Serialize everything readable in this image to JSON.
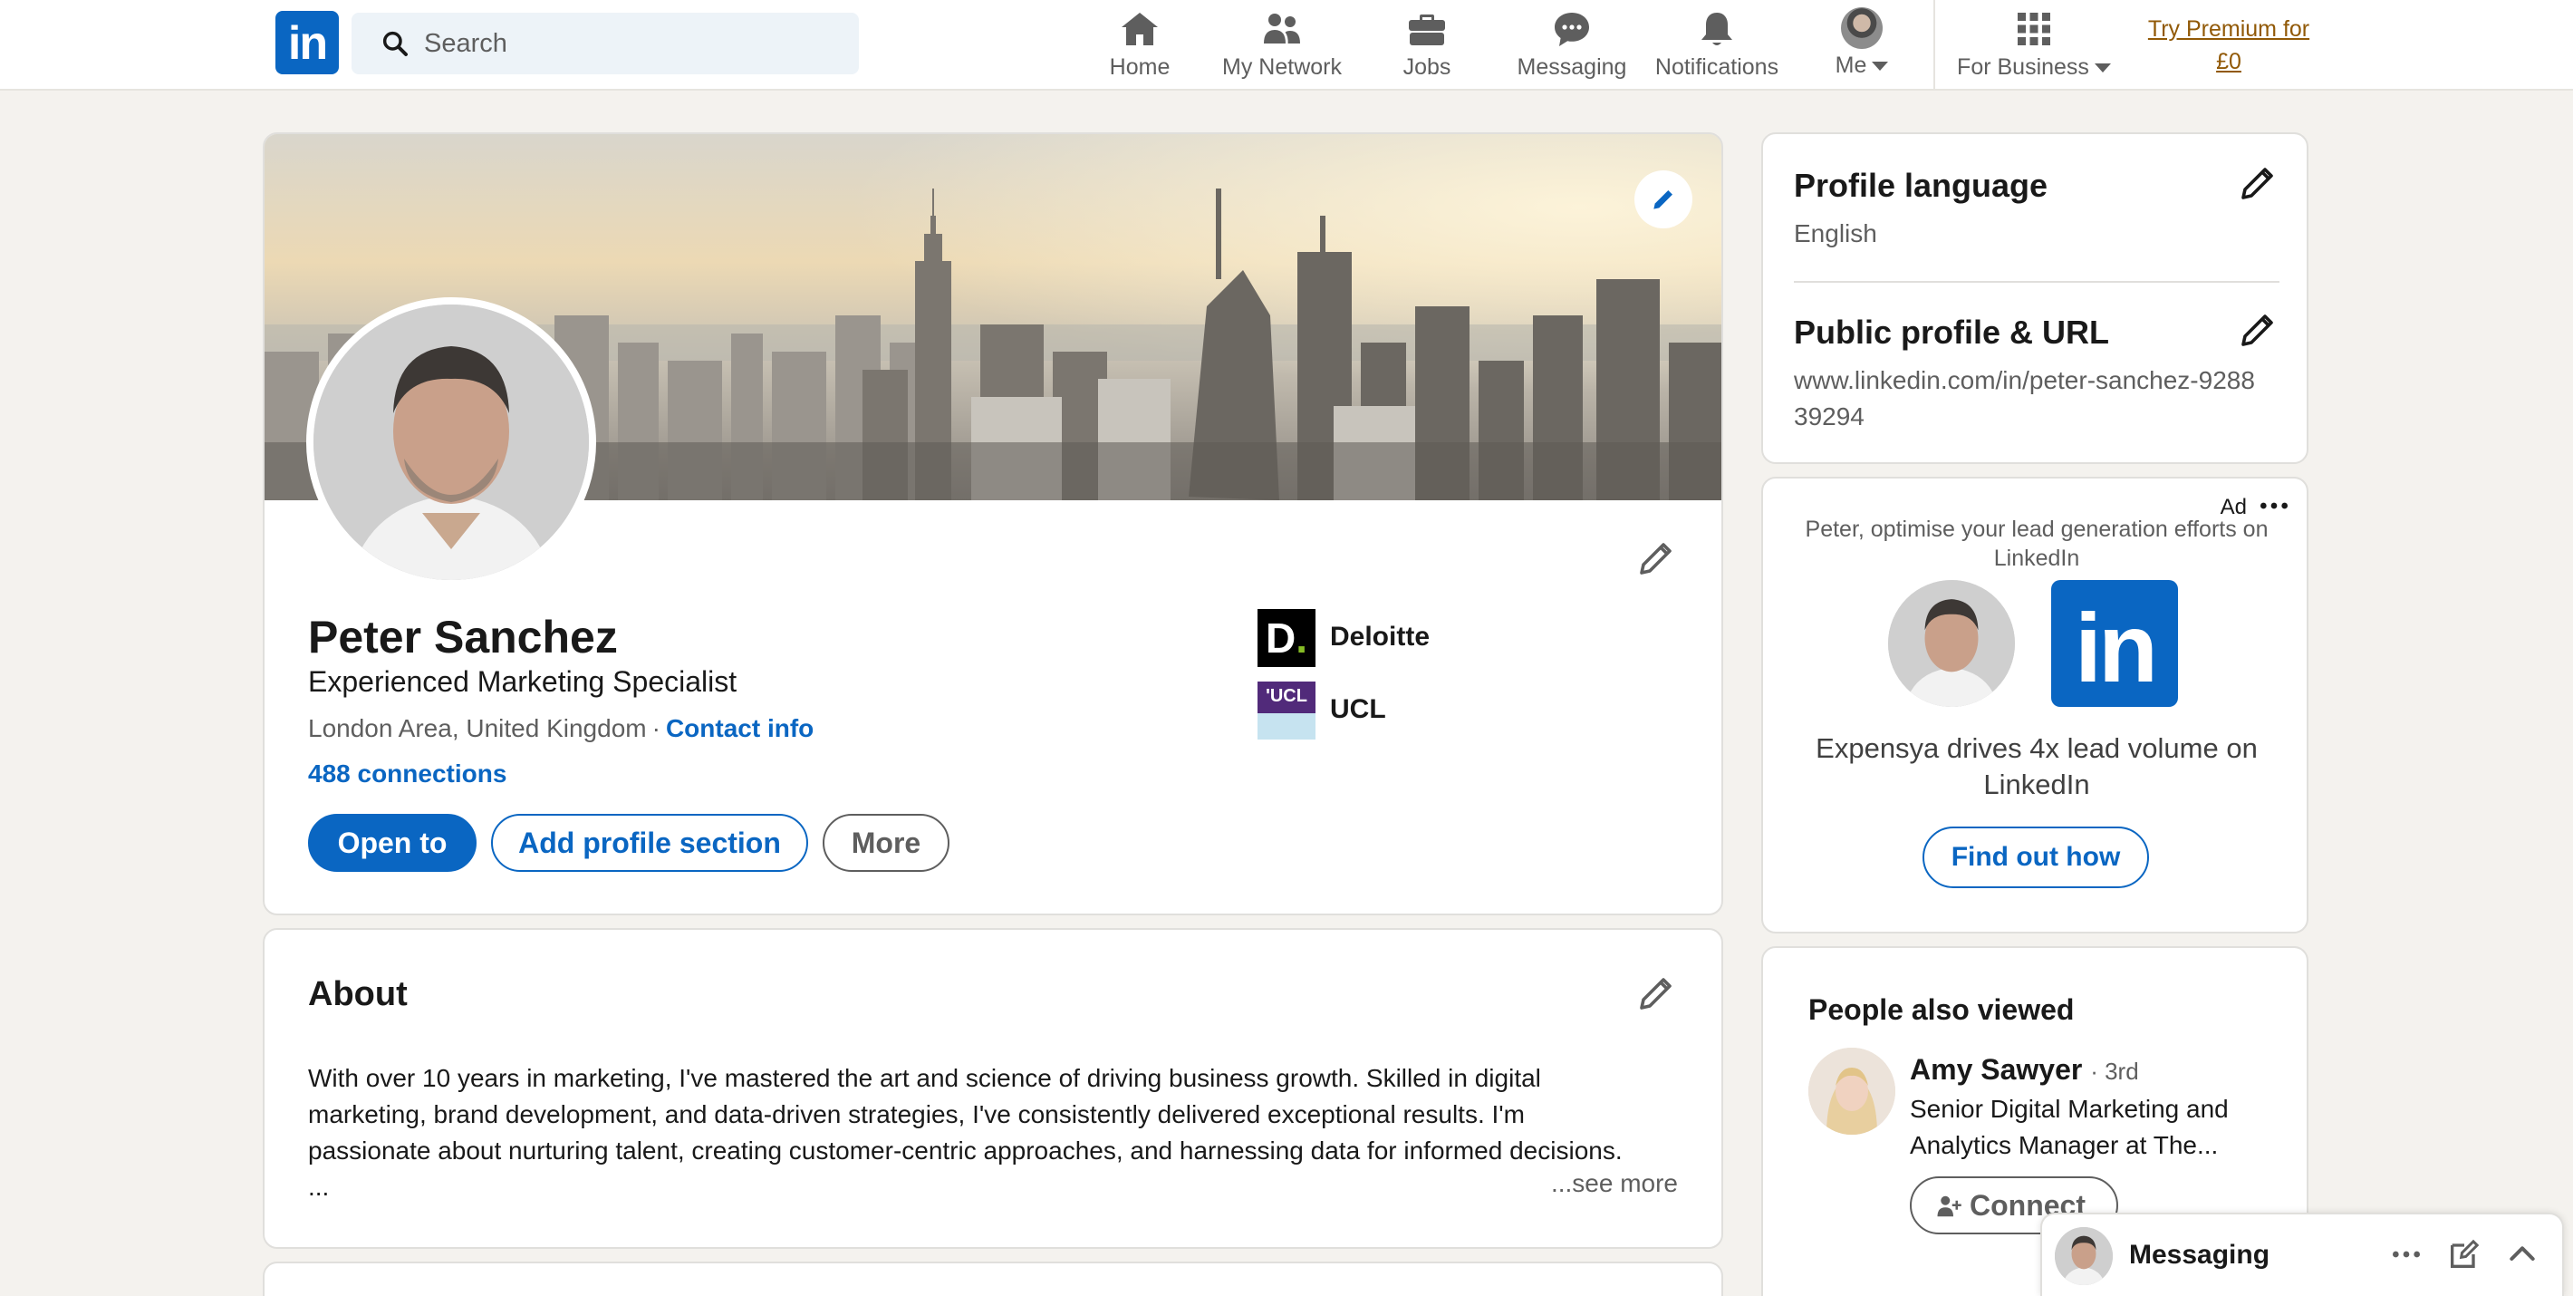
{
  "nav": {
    "logo_text": "in",
    "search_placeholder": "Search",
    "items": [
      {
        "label": "Home",
        "icon": "home-icon"
      },
      {
        "label": "My Network",
        "icon": "network-icon"
      },
      {
        "label": "Jobs",
        "icon": "briefcase-icon"
      },
      {
        "label": "Messaging",
        "icon": "chat-icon"
      },
      {
        "label": "Notifications",
        "icon": "bell-icon"
      },
      {
        "label": "Me",
        "icon": "avatar"
      },
      {
        "label": "For Business",
        "icon": "grid-icon"
      }
    ],
    "premium_line1": "Try Premium for",
    "premium_line2": "£0"
  },
  "profile": {
    "name": "Peter Sanchez",
    "headline": "Experienced Marketing Specialist",
    "location": "London Area, United Kingdom",
    "separator": "·",
    "contact_info": "Contact info",
    "connections": "488 connections",
    "buttons": {
      "open_to": "Open to",
      "add_section": "Add profile section",
      "more": "More"
    },
    "experience": [
      {
        "name": "Deloitte",
        "logo_text": "D"
      },
      {
        "name": "UCL",
        "logo_text": "'UCL"
      }
    ]
  },
  "about": {
    "title": "About",
    "text": "With over 10 years in marketing, I've mastered the art and science of driving business growth. Skilled in digital marketing, brand development, and data-driven strategies, I've consistently delivered exceptional results. I'm passionate about nurturing talent, creating customer-centric approaches, and harnessing data for informed decisions. ...",
    "see_more": "...see more"
  },
  "sidebar": {
    "profile_language": {
      "title": "Profile language",
      "value": "English"
    },
    "public_profile": {
      "title": "Public profile & URL",
      "value": "www.linkedin.com/in/peter-sanchez-928839294"
    },
    "ad": {
      "label": "Ad",
      "pitch": "Peter, optimise your lead generation efforts on LinkedIn",
      "logo_text": "in",
      "copy": "Expensya drives 4x lead volume on LinkedIn",
      "button": "Find out how"
    },
    "people_also_viewed": {
      "title": "People also viewed",
      "people": [
        {
          "name": "Amy Sawyer",
          "degree": "· 3rd",
          "description": "Senior Digital Marketing and Analytics Manager at The...",
          "button": "Connect"
        }
      ]
    }
  },
  "messaging": {
    "label": "Messaging"
  },
  "colors": {
    "brand": "#0a66c2",
    "premium": "#915907",
    "background": "#f4f2ee"
  }
}
